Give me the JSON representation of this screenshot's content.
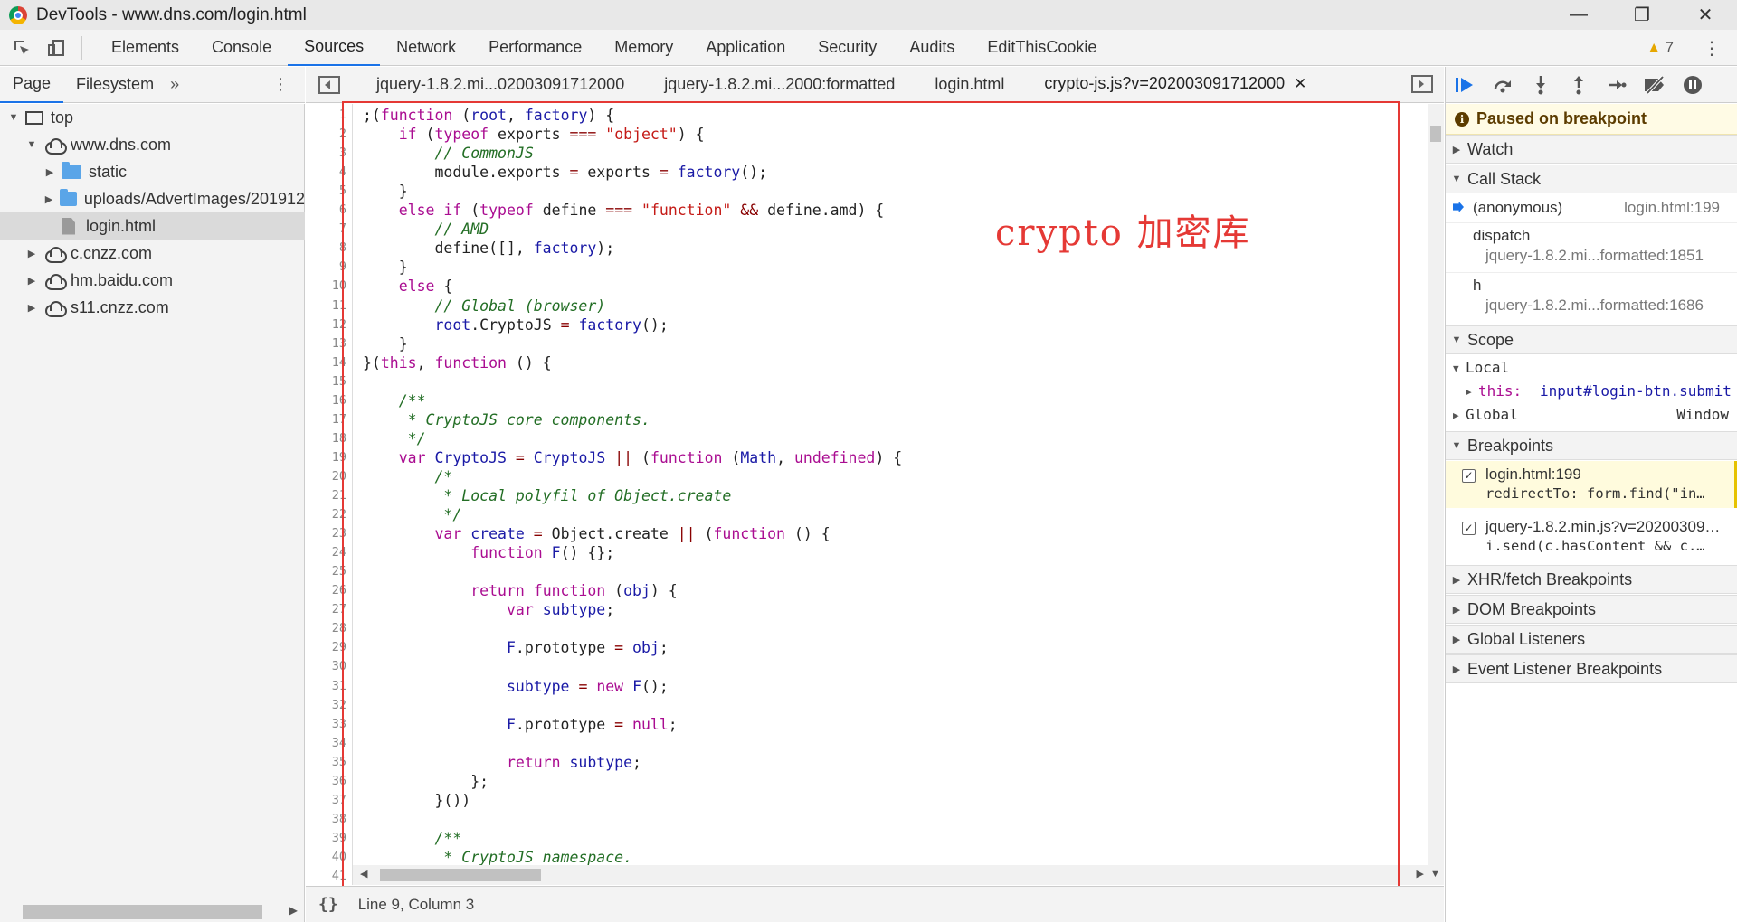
{
  "window": {
    "title": "DevTools - www.dns.com/login.html",
    "minimize": "—",
    "restore": "❐",
    "close": "✕"
  },
  "toolbar": {
    "tabs": [
      "Elements",
      "Console",
      "Sources",
      "Network",
      "Performance",
      "Memory",
      "Application",
      "Security",
      "Audits",
      "EditThisCookie"
    ],
    "active_tab": "Sources",
    "warning_count": "7",
    "kebab": "⋮"
  },
  "navigator": {
    "tabs": [
      "Page",
      "Filesystem"
    ],
    "more": "»",
    "kebab": "⋮",
    "tree": [
      {
        "label": "top",
        "icon": "frame-icon",
        "level": 0,
        "arrow": "▼"
      },
      {
        "label": "www.dns.com",
        "icon": "cloud-icon",
        "level": 1,
        "arrow": "▼"
      },
      {
        "label": "static",
        "icon": "folder-icon",
        "level": 2,
        "arrow": "▶"
      },
      {
        "label": "uploads/AdvertImages/201912",
        "icon": "folder-icon",
        "level": 2,
        "arrow": "▶"
      },
      {
        "label": "login.html",
        "icon": "file-icon",
        "level": 2,
        "arrow": "",
        "selected": true
      },
      {
        "label": "c.cnzz.com",
        "icon": "cloud-icon",
        "level": 1,
        "arrow": "▶"
      },
      {
        "label": "hm.baidu.com",
        "icon": "cloud-icon",
        "level": 1,
        "arrow": "▶"
      },
      {
        "label": "s11.cnzz.com",
        "icon": "cloud-icon",
        "level": 1,
        "arrow": "▶"
      }
    ]
  },
  "editor": {
    "tabs": [
      {
        "label": "jquery-1.8.2.mi...02003091712000",
        "active": false
      },
      {
        "label": "jquery-1.8.2.mi...2000:formatted",
        "active": false
      },
      {
        "label": "login.html",
        "active": false
      },
      {
        "label": "crypto-js.js?v=202003091712000",
        "active": true,
        "closable": true
      }
    ],
    "close_glyph": "✕",
    "annotation": "crypto 加密库",
    "lines": [
      [
        [
          "p",
          ";("
        ],
        [
          "k",
          "function"
        ],
        [
          "p",
          " ("
        ],
        [
          "i",
          "root"
        ],
        [
          "p",
          ", "
        ],
        [
          "i",
          "factory"
        ],
        [
          "p",
          ") {"
        ]
      ],
      [
        [
          "p",
          "    "
        ],
        [
          "k",
          "if"
        ],
        [
          "p",
          " ("
        ],
        [
          "k",
          "typeof"
        ],
        [
          "p",
          " exports "
        ],
        [
          "o",
          "==="
        ],
        [
          "p",
          " "
        ],
        [
          "s",
          "\"object\""
        ],
        [
          "p",
          ") {"
        ]
      ],
      [
        [
          "p",
          "        "
        ],
        [
          "c",
          "// CommonJS"
        ]
      ],
      [
        [
          "p",
          "        module.exports "
        ],
        [
          "o",
          "="
        ],
        [
          "p",
          " exports "
        ],
        [
          "o",
          "="
        ],
        [
          "p",
          " "
        ],
        [
          "i",
          "factory"
        ],
        [
          "p",
          "();"
        ]
      ],
      [
        [
          "p",
          "    }"
        ]
      ],
      [
        [
          "p",
          "    "
        ],
        [
          "k",
          "else if"
        ],
        [
          "p",
          " ("
        ],
        [
          "k",
          "typeof"
        ],
        [
          "p",
          " define "
        ],
        [
          "o",
          "==="
        ],
        [
          "p",
          " "
        ],
        [
          "s",
          "\"function\""
        ],
        [
          "p",
          " "
        ],
        [
          "o",
          "&&"
        ],
        [
          "p",
          " define.amd) {"
        ]
      ],
      [
        [
          "p",
          "        "
        ],
        [
          "c",
          "// AMD"
        ]
      ],
      [
        [
          "p",
          "        define([], "
        ],
        [
          "i",
          "factory"
        ],
        [
          "p",
          ");"
        ]
      ],
      [
        [
          "p",
          "    }"
        ]
      ],
      [
        [
          "p",
          "    "
        ],
        [
          "k",
          "else"
        ],
        [
          "p",
          " {"
        ]
      ],
      [
        [
          "p",
          "        "
        ],
        [
          "c",
          "// Global (browser)"
        ]
      ],
      [
        [
          "p",
          "        "
        ],
        [
          "i",
          "root"
        ],
        [
          "p",
          ".CryptoJS "
        ],
        [
          "o",
          "="
        ],
        [
          "p",
          " "
        ],
        [
          "i",
          "factory"
        ],
        [
          "p",
          "();"
        ]
      ],
      [
        [
          "p",
          "    }"
        ]
      ],
      [
        [
          "p",
          "}("
        ],
        [
          "k",
          "this"
        ],
        [
          "p",
          ", "
        ],
        [
          "k",
          "function"
        ],
        [
          "p",
          " () {"
        ]
      ],
      [
        [
          "p",
          ""
        ]
      ],
      [
        [
          "p",
          "    "
        ],
        [
          "c",
          "/**"
        ]
      ],
      [
        [
          "p",
          "     "
        ],
        [
          "c",
          "* CryptoJS core components."
        ]
      ],
      [
        [
          "p",
          "     "
        ],
        [
          "c",
          "*/"
        ]
      ],
      [
        [
          "p",
          "    "
        ],
        [
          "k",
          "var"
        ],
        [
          "p",
          " "
        ],
        [
          "i",
          "CryptoJS"
        ],
        [
          "p",
          " "
        ],
        [
          "o",
          "="
        ],
        [
          "p",
          " "
        ],
        [
          "i",
          "CryptoJS"
        ],
        [
          "p",
          " "
        ],
        [
          "o",
          "||"
        ],
        [
          "p",
          " ("
        ],
        [
          "k",
          "function"
        ],
        [
          "p",
          " ("
        ],
        [
          "i",
          "Math"
        ],
        [
          "p",
          ", "
        ],
        [
          "k",
          "undefined"
        ],
        [
          "p",
          ") {"
        ]
      ],
      [
        [
          "p",
          "        "
        ],
        [
          "c",
          "/*"
        ]
      ],
      [
        [
          "p",
          "         "
        ],
        [
          "c",
          "* Local polyfil of Object.create"
        ]
      ],
      [
        [
          "p",
          "         "
        ],
        [
          "c",
          "*/"
        ]
      ],
      [
        [
          "p",
          "        "
        ],
        [
          "k",
          "var"
        ],
        [
          "p",
          " "
        ],
        [
          "i",
          "create"
        ],
        [
          "p",
          " "
        ],
        [
          "o",
          "="
        ],
        [
          "p",
          " Object.create "
        ],
        [
          "o",
          "||"
        ],
        [
          "p",
          " ("
        ],
        [
          "k",
          "function"
        ],
        [
          "p",
          " () {"
        ]
      ],
      [
        [
          "p",
          "            "
        ],
        [
          "k",
          "function"
        ],
        [
          "p",
          " "
        ],
        [
          "i",
          "F"
        ],
        [
          "p",
          "() {};"
        ]
      ],
      [
        [
          "p",
          ""
        ]
      ],
      [
        [
          "p",
          "            "
        ],
        [
          "k",
          "return function"
        ],
        [
          "p",
          " ("
        ],
        [
          "i",
          "obj"
        ],
        [
          "p",
          ") {"
        ]
      ],
      [
        [
          "p",
          "                "
        ],
        [
          "k",
          "var"
        ],
        [
          "p",
          " "
        ],
        [
          "i",
          "subtype"
        ],
        [
          "p",
          ";"
        ]
      ],
      [
        [
          "p",
          ""
        ]
      ],
      [
        [
          "p",
          "                "
        ],
        [
          "i",
          "F"
        ],
        [
          "p",
          ".prototype "
        ],
        [
          "o",
          "="
        ],
        [
          "p",
          " "
        ],
        [
          "i",
          "obj"
        ],
        [
          "p",
          ";"
        ]
      ],
      [
        [
          "p",
          ""
        ]
      ],
      [
        [
          "p",
          "                "
        ],
        [
          "i",
          "subtype"
        ],
        [
          "p",
          " "
        ],
        [
          "o",
          "="
        ],
        [
          "p",
          " "
        ],
        [
          "k",
          "new"
        ],
        [
          "p",
          " "
        ],
        [
          "i",
          "F"
        ],
        [
          "p",
          "();"
        ]
      ],
      [
        [
          "p",
          ""
        ]
      ],
      [
        [
          "p",
          "                "
        ],
        [
          "i",
          "F"
        ],
        [
          "p",
          ".prototype "
        ],
        [
          "o",
          "="
        ],
        [
          "p",
          " "
        ],
        [
          "k",
          "null"
        ],
        [
          "p",
          ";"
        ]
      ],
      [
        [
          "p",
          ""
        ]
      ],
      [
        [
          "p",
          "                "
        ],
        [
          "k",
          "return"
        ],
        [
          "p",
          " "
        ],
        [
          "i",
          "subtype"
        ],
        [
          "p",
          ";"
        ]
      ],
      [
        [
          "p",
          "            };"
        ]
      ],
      [
        [
          "p",
          "        }())"
        ]
      ],
      [
        [
          "p",
          ""
        ]
      ],
      [
        [
          "p",
          "        "
        ],
        [
          "c",
          "/**"
        ]
      ],
      [
        [
          "p",
          "         "
        ],
        [
          "c",
          "* CryptoJS namespace."
        ]
      ],
      [
        [
          "p",
          ""
        ]
      ]
    ]
  },
  "status": {
    "braces": "{}",
    "position": "Line 9, Column 3"
  },
  "debugger": {
    "paused_text": "Paused on breakpoint",
    "watch": "Watch",
    "call_stack": "Call Stack",
    "stack": [
      {
        "fn": "(anonymous)",
        "loc": "login.html:199",
        "current": true
      },
      {
        "fn": "dispatch",
        "loc": "jquery-1.8.2.mi...formatted:1851"
      },
      {
        "fn": "h",
        "loc": "jquery-1.8.2.mi...formatted:1686"
      }
    ],
    "scope": "Scope",
    "local": "Local",
    "this_key": "this: ",
    "this_val": "input#login-btn.submit",
    "global": "Global",
    "global_val": "Window",
    "breakpoints": "Breakpoints",
    "bps": [
      {
        "file": "login.html:199",
        "code": "redirectTo: form.find(\"in…",
        "active": true
      },
      {
        "file": "jquery-1.8.2.min.js?v=20200309…",
        "code": "i.send(c.hasContent && c.…",
        "active": false
      }
    ],
    "sections": [
      "XHR/fetch Breakpoints",
      "DOM Breakpoints",
      "Global Listeners",
      "Event Listener Breakpoints"
    ]
  }
}
